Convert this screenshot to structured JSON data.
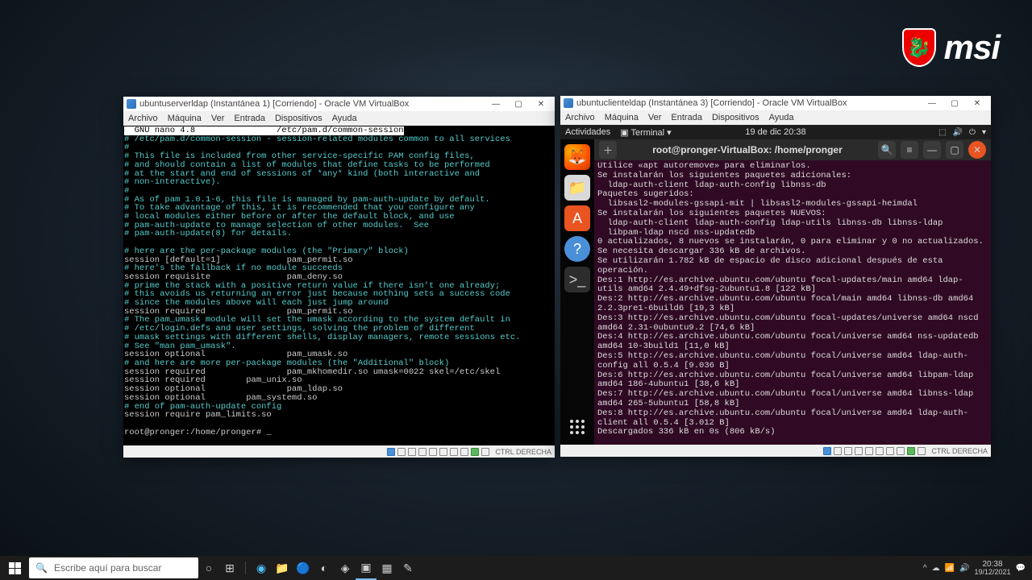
{
  "brand": {
    "text": "msi"
  },
  "vm_left": {
    "title": "ubuntuserverldap (Instantánea 1) [Corriendo] - Oracle VM VirtualBox",
    "menus": [
      "Archivo",
      "Máquina",
      "Ver",
      "Entrada",
      "Dispositivos",
      "Ayuda"
    ],
    "hostkey": "CTRL DERECHA",
    "nano": {
      "header_left": "  GNU nano 4.8",
      "header_right": "/etc/pam.d/common-session",
      "lines": [
        {
          "c": "c",
          "t": "# /etc/pam.d/common-session - session-related modules common to all services"
        },
        {
          "c": "c",
          "t": "#"
        },
        {
          "c": "c",
          "t": "# This file is included from other service-specific PAM config files,"
        },
        {
          "c": "c",
          "t": "# and should contain a list of modules that define tasks to be performed"
        },
        {
          "c": "c",
          "t": "# at the start and end of sessions of *any* kind (both interactive and"
        },
        {
          "c": "c",
          "t": "# non-interactive)."
        },
        {
          "c": "c",
          "t": "#"
        },
        {
          "c": "c",
          "t": "# As of pam 1.0.1-6, this file is managed by pam-auth-update by default."
        },
        {
          "c": "c",
          "t": "# To take advantage of this, it is recommended that you configure any"
        },
        {
          "c": "c",
          "t": "# local modules either before or after the default block, and use"
        },
        {
          "c": "c",
          "t": "# pam-auth-update to manage selection of other modules.  See"
        },
        {
          "c": "c",
          "t": "# pam-auth-update(8) for details."
        },
        {
          "c": "w",
          "t": ""
        },
        {
          "c": "c",
          "t": "# here are the per-package modules (the \"Primary\" block)"
        },
        {
          "c": "w",
          "t": "session [default=1]             pam_permit.so"
        },
        {
          "c": "c",
          "t": "# here's the fallback if no module succeeds"
        },
        {
          "c": "w",
          "t": "session requisite               pam_deny.so"
        },
        {
          "c": "c",
          "t": "# prime the stack with a positive return value if there isn't one already;"
        },
        {
          "c": "c",
          "t": "# this avoids us returning an error just because nothing sets a success code"
        },
        {
          "c": "c",
          "t": "# since the modules above will each just jump around"
        },
        {
          "c": "w",
          "t": "session required                pam_permit.so"
        },
        {
          "c": "c",
          "t": "# The pam_umask module will set the umask according to the system default in"
        },
        {
          "c": "c",
          "t": "# /etc/login.defs and user settings, solving the problem of different"
        },
        {
          "c": "c",
          "t": "# umask settings with different shells, display managers, remote sessions etc."
        },
        {
          "c": "c",
          "t": "# See \"man pam_umask\"."
        },
        {
          "c": "w",
          "t": "session optional                pam_umask.so"
        },
        {
          "c": "c",
          "t": "# and here are more per-package modules (the \"Additional\" block)"
        },
        {
          "c": "w",
          "t": "session required                pam_mkhomedir.so umask=0022 skel=/etc/skel"
        },
        {
          "c": "w",
          "t": "session required        pam_unix.so"
        },
        {
          "c": "w",
          "t": "session optional                pam_ldap.so"
        },
        {
          "c": "w",
          "t": "session optional        pam_systemd.so"
        },
        {
          "c": "c",
          "t": "# end of pam-auth-update config"
        },
        {
          "c": "w",
          "t": "session require pam_limits.so"
        },
        {
          "c": "w",
          "t": ""
        },
        {
          "c": "w",
          "t": "root@pronger:/home/pronger# _"
        }
      ]
    }
  },
  "vm_right": {
    "title": "ubuntuclienteldap (Instantánea 3) [Corriendo] - Oracle VM VirtualBox",
    "menus": [
      "Archivo",
      "Máquina",
      "Ver",
      "Entrada",
      "Dispositivos",
      "Ayuda"
    ],
    "hostkey": "CTRL DERECHA",
    "ubuntu_top": {
      "activities": "Actividades",
      "appname": "Terminal ▾",
      "datetime": "19 de dic 20:38"
    },
    "terminal": {
      "title": "root@pronger-VirtualBox: /home/pronger",
      "body": "Utilice «apt autoremove» para eliminarlos.\nSe instalarán los siguientes paquetes adicionales:\n  ldap-auth-client ldap-auth-config libnss-db\nPaquetes sugeridos:\n  libsasl2-modules-gssapi-mit | libsasl2-modules-gssapi-heimdal\nSe instalarán los siguientes paquetes NUEVOS:\n  ldap-auth-client ldap-auth-config ldap-utils libnss-db libnss-ldap\n  libpam-ldap nscd nss-updatedb\n0 actualizados, 8 nuevos se instalarán, 0 para eliminar y 0 no actualizados.\nSe necesita descargar 336 kB de archivos.\nSe utilizarán 1.782 kB de espacio de disco adicional después de esta operación.\nDes:1 http://es.archive.ubuntu.com/ubuntu focal-updates/main amd64 ldap-utils amd64 2.4.49+dfsg-2ubuntu1.8 [122 kB]\nDes:2 http://es.archive.ubuntu.com/ubuntu focal/main amd64 libnss-db amd64 2.2.3pre1-6build6 [19,3 kB]\nDes:3 http://es.archive.ubuntu.com/ubuntu focal-updates/universe amd64 nscd amd64 2.31-0ubuntu9.2 [74,6 kB]\nDes:4 http://es.archive.ubuntu.com/ubuntu focal/universe amd64 nss-updatedb amd64 10-3build1 [11,0 kB]\nDes:5 http://es.archive.ubuntu.com/ubuntu focal/universe amd64 ldap-auth-config all 0.5.4 [9.036 B]\nDes:6 http://es.archive.ubuntu.com/ubuntu focal/universe amd64 libpam-ldap amd64 186-4ubuntu1 [38,6 kB]\nDes:7 http://es.archive.ubuntu.com/ubuntu focal/universe amd64 libnss-ldap amd64 265-5ubuntu1 [58,8 kB]\nDes:8 http://es.archive.ubuntu.com/ubuntu focal/universe amd64 ldap-auth-client all 0.5.4 [3.012 B]\nDescargados 336 kB en 0s (806 kB/s)"
    }
  },
  "taskbar": {
    "search_placeholder": "Escribe aquí para buscar",
    "time": "20:38",
    "date": "19/12/2021"
  }
}
